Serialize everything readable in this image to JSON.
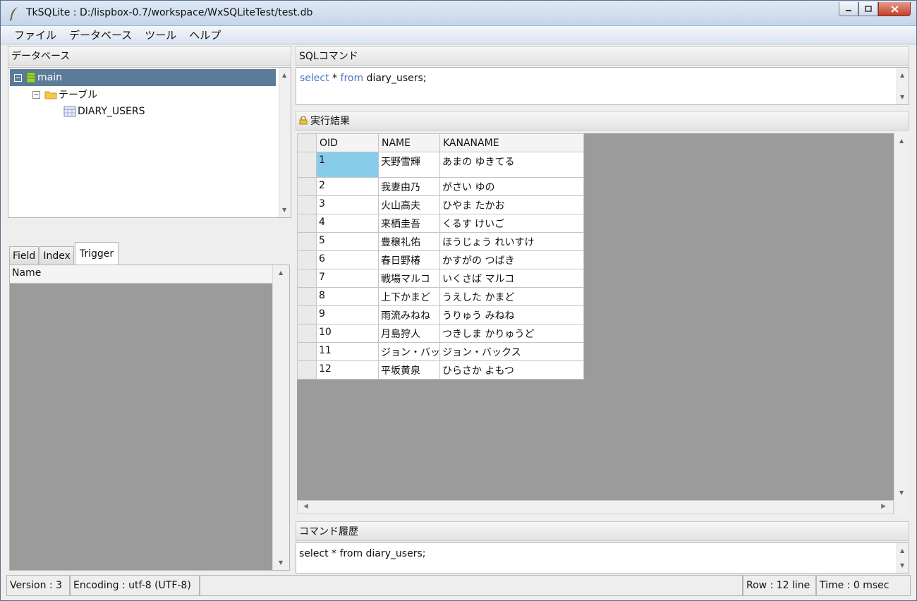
{
  "window": {
    "title": "TkSQLite : D:/lispbox-0.7/workspace/WxSQLiteTest/test.db"
  },
  "menu": [
    "ファイル",
    "データベース",
    "ツール",
    "ヘルプ"
  ],
  "database_panel": {
    "header": "データベース",
    "tree": {
      "root": "main",
      "folder": "テーブル",
      "table": "DIARY_USERS"
    }
  },
  "tabs": [
    "Field",
    "Index",
    "Trigger"
  ],
  "trigger_panel": {
    "column_header": "Name"
  },
  "sql_panel": {
    "header": "SQLコマンド",
    "keyword_select": "select",
    "star": " * ",
    "keyword_from": "from",
    "rest": " diary_users;"
  },
  "result_panel": {
    "header": "実行結果",
    "columns": [
      "OID",
      "NAME",
      "KANANAME"
    ],
    "rows": [
      [
        "1",
        "天野雪輝",
        "あまの ゆきてる"
      ],
      [
        "2",
        "我妻由乃",
        "がさい ゆの"
      ],
      [
        "3",
        "火山高夫",
        "ひやま たかお"
      ],
      [
        "4",
        "来栖圭吾",
        "くるす けいご"
      ],
      [
        "5",
        "豊穣礼佑",
        "ほうじょう れいすけ"
      ],
      [
        "6",
        "春日野椿",
        "かすがの つばき"
      ],
      [
        "7",
        "戦場マルコ",
        "いくさば マルコ"
      ],
      [
        "8",
        "上下かまど",
        "うえした かまど"
      ],
      [
        "9",
        "雨流みねね",
        "うりゅう みねね"
      ],
      [
        "10",
        "月島狩人",
        "つきしま かりゅうど"
      ],
      [
        "11",
        "ジョン・バッ",
        "ジョン・バックス"
      ],
      [
        "12",
        "平坂黄泉",
        "ひらさか よもつ"
      ]
    ]
  },
  "history_panel": {
    "header": "コマンド履歴",
    "text": "select * from diary_users;"
  },
  "status": {
    "version": "Version : 3",
    "encoding": "Encoding : utf-8 (UTF-8)",
    "rows": "Row : 12 line",
    "time": "Time : 0 msec"
  },
  "colors": {
    "selection": "#5b7b99",
    "selected_cell": "#87cdeb",
    "sql_keyword": "#4a74c9",
    "grid_background": "#9b9b9b"
  }
}
